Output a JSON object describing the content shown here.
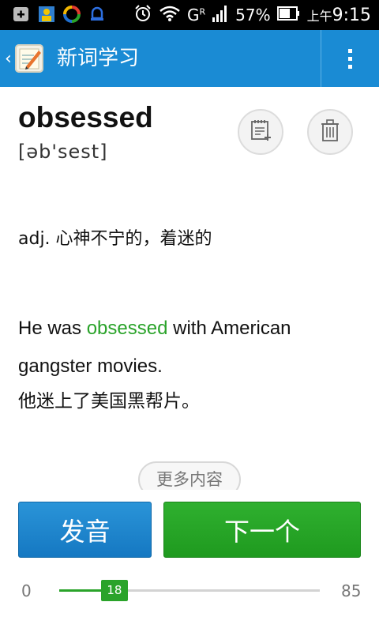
{
  "status_bar": {
    "network_label": "G",
    "network_superscript": "R",
    "battery": "57%",
    "time_prefix": "上午",
    "time": "9:15",
    "icons": [
      "add-box-icon",
      "photo-icon",
      "sync-icon",
      "notification-icon",
      "alarm-icon",
      "wifi-icon",
      "signal-icon",
      "battery-icon"
    ]
  },
  "app_bar": {
    "title": "新词学习",
    "back_icon": "chevron-left-icon",
    "logo_icon": "word-notebook-icon",
    "menu_icon": "overflow-menu-icon",
    "color": "#1a8bd4"
  },
  "word": {
    "text": "obsessed",
    "phonetic": "[əb'sest]"
  },
  "actions_icons": {
    "add": "add-to-list-icon",
    "delete": "trash-icon"
  },
  "definition": "adj. 心神不宁的，着迷的",
  "example": {
    "before": "He was ",
    "highlight": "obsessed",
    "after": " with American gangster movies.",
    "translation": "他迷上了美国黑帮片。",
    "highlight_color": "#2aa32a"
  },
  "more_button": "更多内容",
  "buttons": {
    "speak": "发音",
    "next": "下一个"
  },
  "progress": {
    "min": "0",
    "max": "85",
    "current": "18",
    "value": 18,
    "range": [
      0,
      85
    ],
    "color": "#2aa32a"
  }
}
